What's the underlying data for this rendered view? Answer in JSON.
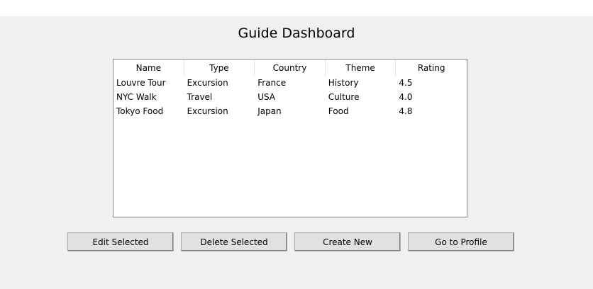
{
  "window": {
    "title": "Guide Dashboard"
  },
  "table": {
    "columns": [
      "Name",
      "Type",
      "Country",
      "Theme",
      "Rating"
    ],
    "rows": [
      [
        "Louvre Tour",
        "Excursion",
        "France",
        "History",
        "4.5"
      ],
      [
        "NYC Walk",
        "Travel",
        "USA",
        "Culture",
        "4.0"
      ],
      [
        "Tokyo Food",
        "Excursion",
        "Japan",
        "Food",
        "4.8"
      ]
    ]
  },
  "buttons": {
    "edit": "Edit Selected",
    "delete": "Delete Selected",
    "create": "Create New",
    "profile": "Go to Profile"
  }
}
